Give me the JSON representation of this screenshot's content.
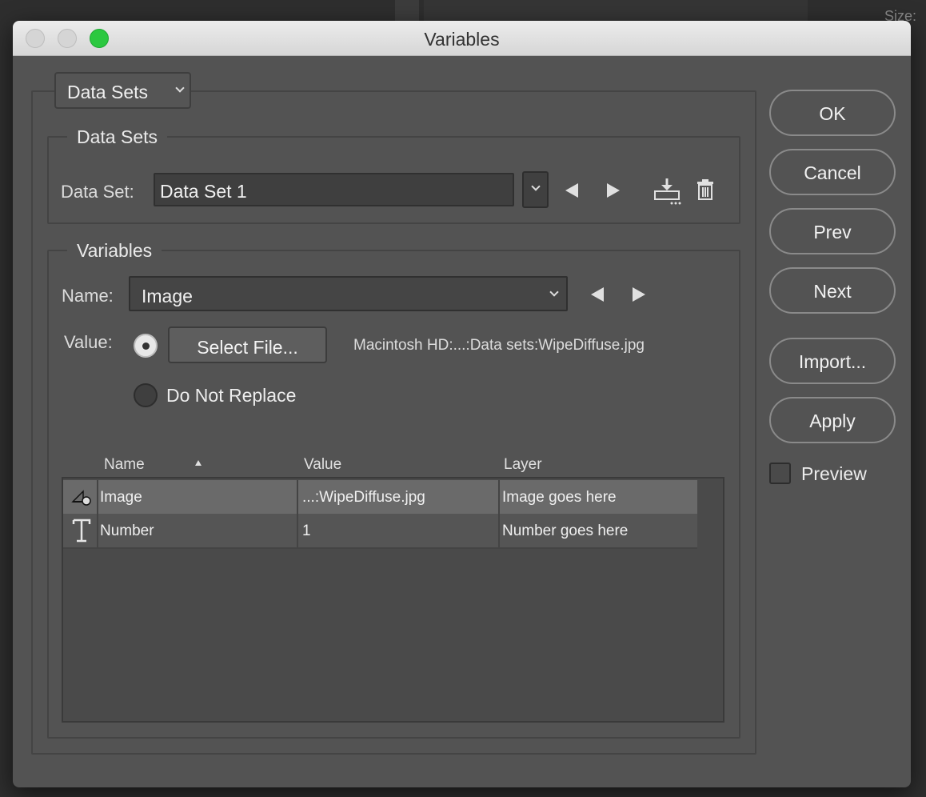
{
  "window": {
    "title": "Variables"
  },
  "background": {
    "size_label": "Size:"
  },
  "mode_select": {
    "value": "Data Sets"
  },
  "data_sets_group": {
    "title": "Data Sets",
    "data_set_label": "Data Set:",
    "data_set_value": "Data Set 1"
  },
  "variables_group": {
    "title": "Variables",
    "name_label": "Name:",
    "name_value": "Image",
    "value_label": "Value:",
    "select_file_label": "Select File...",
    "file_path": "Macintosh HD:...:Data sets:WipeDiffuse.jpg",
    "do_not_replace_label": "Do Not Replace",
    "selected_option": "select_file"
  },
  "table": {
    "columns": [
      "Name",
      "Value",
      "Layer"
    ],
    "sort_column": "Name",
    "sort_direction": "ascending",
    "rows": [
      {
        "icon": "image-variable-icon",
        "name": "Image",
        "value": "...:WipeDiffuse.jpg",
        "layer": "Image goes here",
        "selected": true
      },
      {
        "icon": "text-variable-icon",
        "name": "Number",
        "value": "1",
        "layer": "Number goes here",
        "selected": false
      }
    ]
  },
  "buttons": {
    "ok": "OK",
    "cancel": "Cancel",
    "prev": "Prev",
    "next": "Next",
    "import": "Import...",
    "apply": "Apply"
  },
  "preview": {
    "label": "Preview",
    "checked": false
  },
  "colors": {
    "dialog_bg": "#535353",
    "titlebar": "#e0e0e0",
    "maximize_green": "#2bc840",
    "selected_row": "#6a6a6a"
  }
}
